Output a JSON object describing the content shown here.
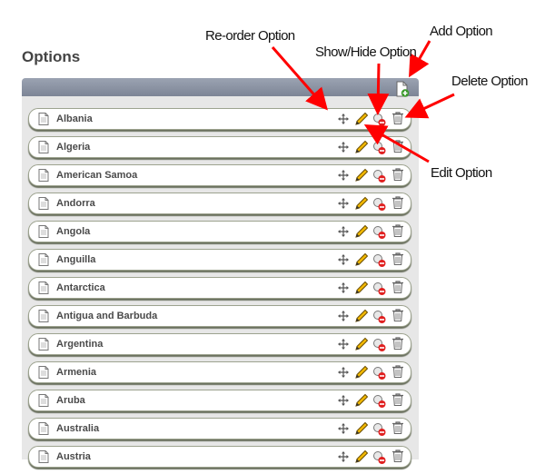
{
  "page": {
    "title": "Options"
  },
  "annotations": {
    "reorder": "Re-order Option",
    "show_hide": "Show/Hide Option",
    "add": "Add Option",
    "delete": "Delete Option",
    "edit": "Edit Option"
  },
  "colors": {
    "arrow": "#ff0000",
    "header": "#8a92a2",
    "edit": "#f2b800",
    "hide": "#e02020"
  },
  "header_icon": "add-document-icon",
  "row_icons": [
    "document-icon",
    "move-icon",
    "pencil-icon",
    "show-hide-icon",
    "trash-icon"
  ],
  "options": [
    {
      "label": "Albania"
    },
    {
      "label": "Algeria"
    },
    {
      "label": "American Samoa"
    },
    {
      "label": "Andorra"
    },
    {
      "label": "Angola"
    },
    {
      "label": "Anguilla"
    },
    {
      "label": "Antarctica"
    },
    {
      "label": "Antigua and Barbuda"
    },
    {
      "label": "Argentina"
    },
    {
      "label": "Armenia"
    },
    {
      "label": "Aruba"
    },
    {
      "label": "Australia"
    },
    {
      "label": "Austria"
    }
  ]
}
